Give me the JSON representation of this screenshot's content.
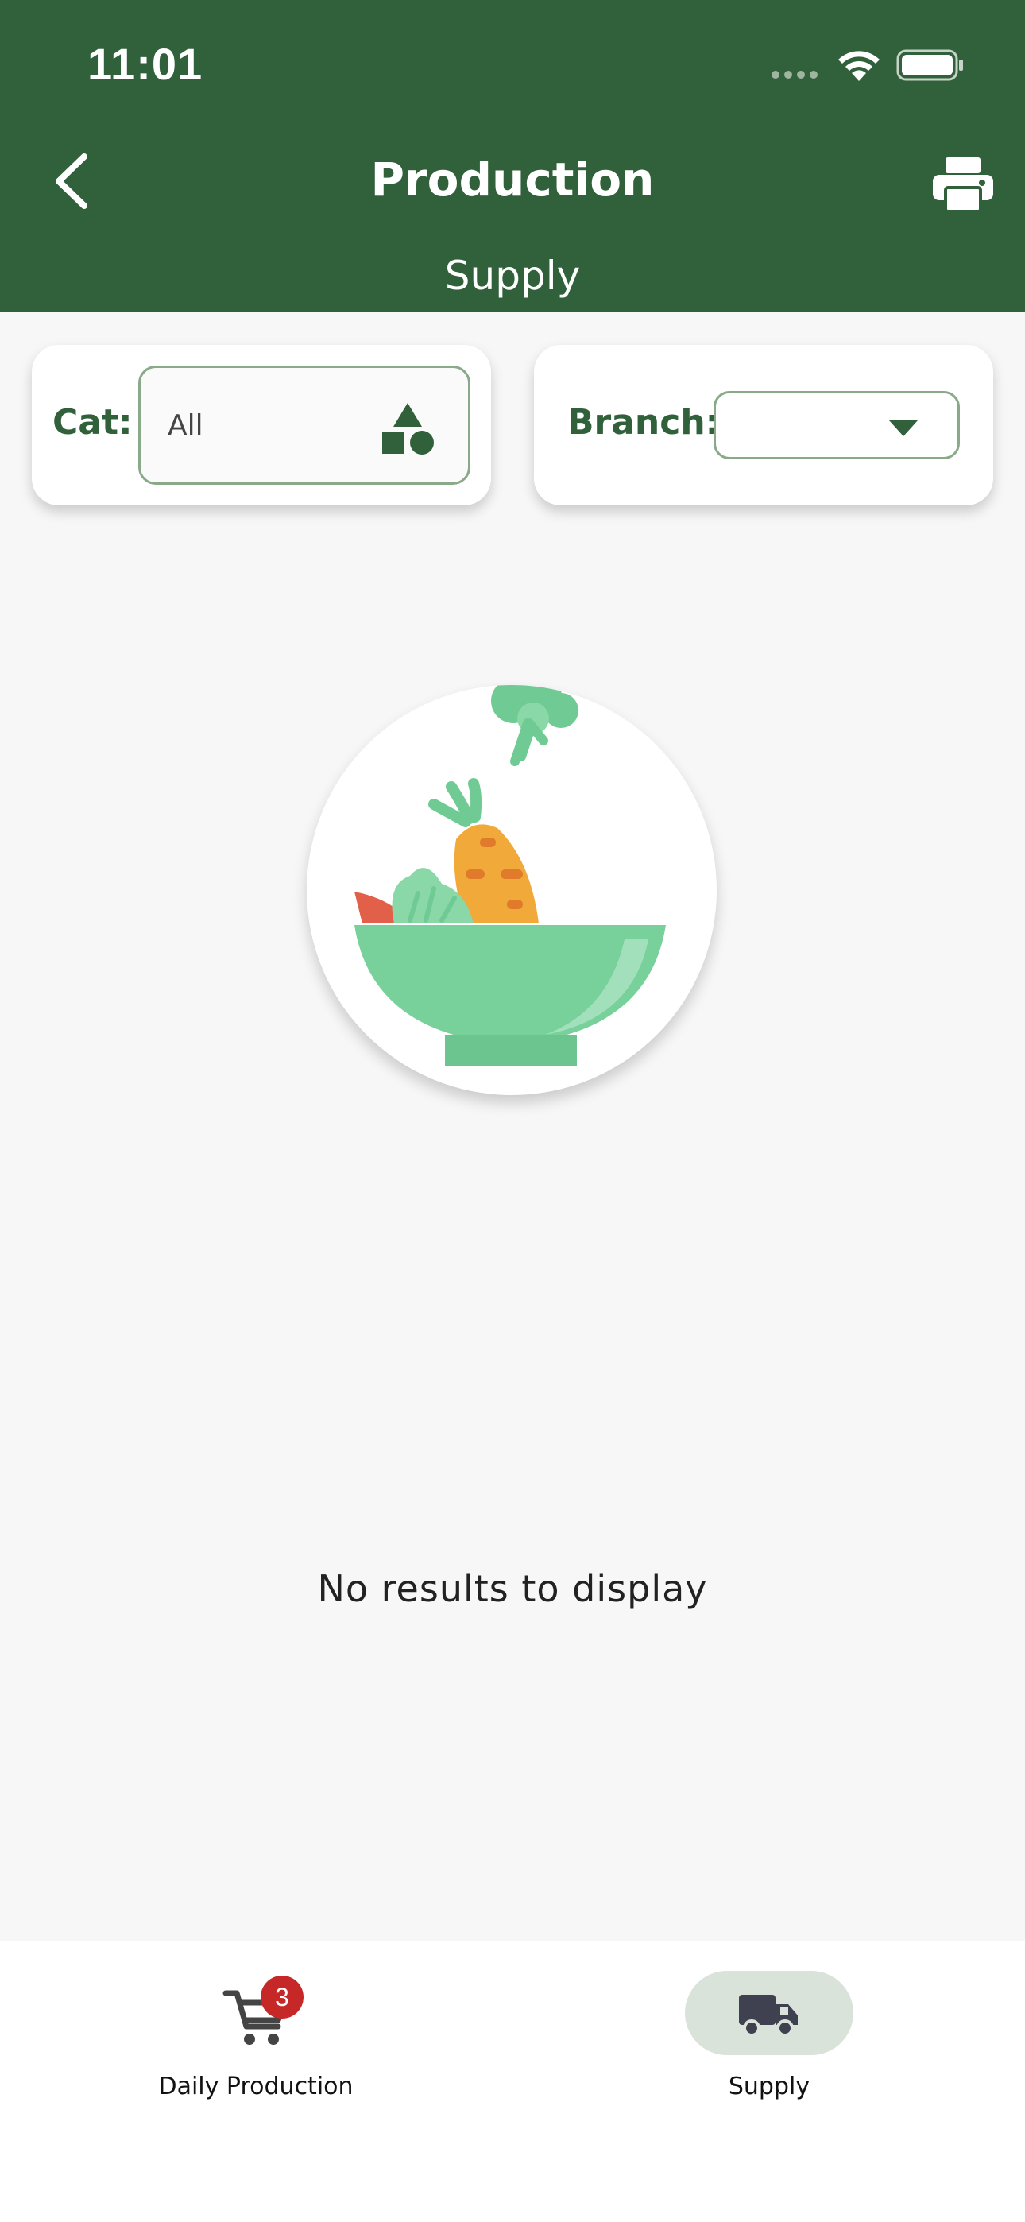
{
  "status_bar": {
    "time": "11:01"
  },
  "header": {
    "title": "Production",
    "subtitle": "Supply",
    "back_icon": "chevron-left-icon",
    "print_icon": "printer-icon"
  },
  "filters": {
    "category": {
      "label": "Cat:",
      "value": "All",
      "icon": "shapes-icon"
    },
    "branch": {
      "label": "Branch:",
      "value": "",
      "icon": "caret-down-icon"
    }
  },
  "empty_state": {
    "illustration": "salad-bowl-illustration",
    "message": "No results to display"
  },
  "bottom_nav": {
    "items": [
      {
        "label": "Daily Production",
        "icon": "cart-icon",
        "badge": "3",
        "active": false
      },
      {
        "label": "Supply",
        "icon": "truck-icon",
        "active": true
      }
    ]
  },
  "colors": {
    "primary": "#30613b",
    "background": "#f7f7f7",
    "badge": "#c62828",
    "active_nav_bg": "#d9e3da",
    "bowl": "#78d09b"
  }
}
